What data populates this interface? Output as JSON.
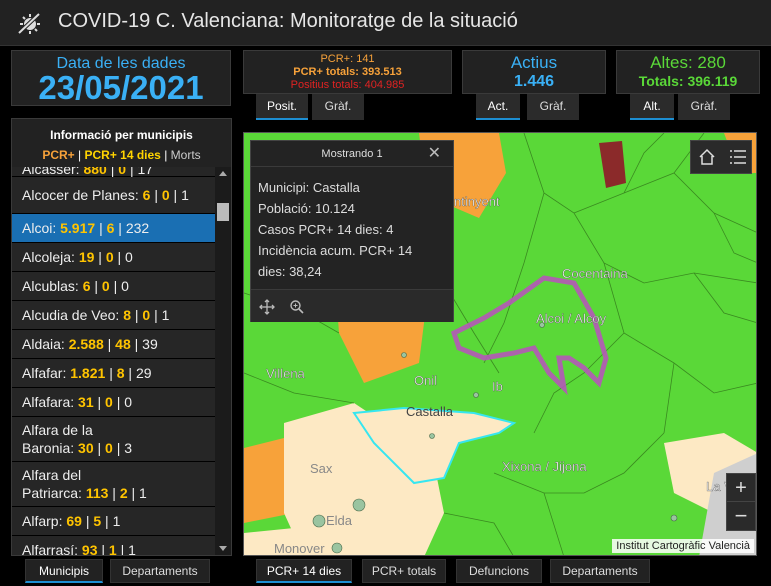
{
  "header": {
    "title": "COVID-19 C. Valenciana: Monitoratge de la situació",
    "logo_icon": "virus-slash-icon"
  },
  "date_panel": {
    "label": "Data de les dades",
    "value": "23/05/2021"
  },
  "pcr_panel": {
    "line1": "PCR+: 141",
    "line2": "PCR+ totals: 393.513",
    "line3": "Positius totals: 404.985",
    "tabs": [
      "Posit.",
      "Gràf."
    ]
  },
  "actius_panel": {
    "label": "Actius",
    "value": "1.446",
    "tabs": [
      "Act.",
      "Gràf."
    ]
  },
  "altes_panel": {
    "label": "Altes: 280",
    "value": "Totals: 396.119",
    "tabs": [
      "Alt.",
      "Gràf."
    ]
  },
  "municipis": {
    "title": "Informació per municipis",
    "legend_a": "PCR+",
    "legend_b": "PCR+ 14 dies",
    "legend_c": "Morts",
    "sep": "|",
    "rows": [
      {
        "name": "Alcasser:",
        "pcr": "880",
        "d14": "0",
        "morts": "17"
      },
      {
        "name": "Alcocer de Planes:",
        "pcr": "6",
        "d14": "0",
        "morts": "1"
      },
      {
        "name": "Alcoi:",
        "pcr": "5.917",
        "d14": "6",
        "morts": "232"
      },
      {
        "name": "Alcoleja:",
        "pcr": "19",
        "d14": "0",
        "morts": "0"
      },
      {
        "name": "Alcublas:",
        "pcr": "6",
        "d14": "0",
        "morts": "0"
      },
      {
        "name": "Alcudia de Veo:",
        "pcr": "8",
        "d14": "0",
        "morts": "1"
      },
      {
        "name": "Aldaia:",
        "pcr": "2.588",
        "d14": "48",
        "morts": "39"
      },
      {
        "name": "Alfafar:",
        "pcr": "1.821",
        "d14": "8",
        "morts": "29"
      },
      {
        "name": "Alfafara:",
        "pcr": "31",
        "d14": "0",
        "morts": "0"
      },
      {
        "name1": "Alfara de la",
        "name": "Baronia:",
        "pcr": "30",
        "d14": "0",
        "morts": "3"
      },
      {
        "name1": "Alfara del",
        "name": "Patriarca:",
        "pcr": "113",
        "d14": "2",
        "morts": "1"
      },
      {
        "name": "Alfarp:",
        "pcr": "69",
        "d14": "5",
        "morts": "1"
      },
      {
        "name": "Alfarrasí:",
        "pcr": "93",
        "d14": "1",
        "morts": "1"
      }
    ]
  },
  "popup": {
    "title": "Mostrando 1",
    "line1": "Municipi: Castalla",
    "line2": "Població: 10.124",
    "line3": "Casos PCR+ 14 dies: 4",
    "line4": "Incidència acum. PCR+ 14",
    "line5": "dies: 38,24"
  },
  "map": {
    "labels": {
      "ontinyent": "ntinyent",
      "cocentaina": "Cocentaina",
      "alcoi": "Alcoi / Alcoy",
      "villena": "Villena",
      "onil": "Onil",
      "ibi": "Ib",
      "castalla": "Castalla",
      "xixona": "Xixona / Jijona",
      "sax": "Sax",
      "elda": "Elda",
      "monover": "Monover",
      "lav": "La V",
      "attribution": "Institut Cartogràfic Valencià"
    },
    "colors": {
      "green": "#5ad838",
      "orange": "#f7a23a",
      "beige": "#fde9c4",
      "darkred": "#8b2a2a",
      "highlight": "#b558b8",
      "cyan": "#36e6f0"
    }
  },
  "bottom_tabs": {
    "left": [
      "Municipis",
      "Departaments"
    ],
    "right": [
      "PCR+ 14 dies",
      "PCR+ totals",
      "Defuncions",
      "Departaments"
    ]
  }
}
